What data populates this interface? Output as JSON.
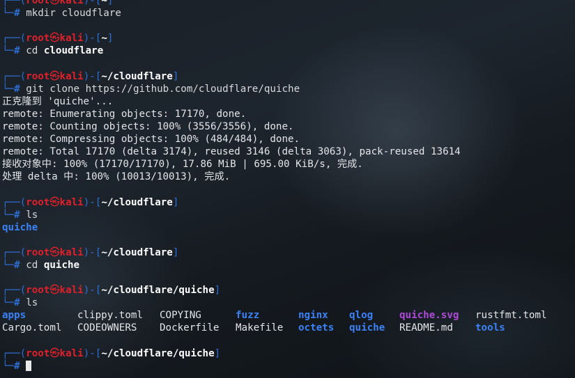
{
  "prompt": {
    "user": "root",
    "skull": "㉿",
    "host": "kali",
    "hash": "#"
  },
  "blocks": [
    {
      "path": "~",
      "cmd": "mkdir",
      "arg": "cloudflare",
      "arg_bold": false
    },
    {
      "path": "~",
      "cmd": "cd",
      "arg": "cloudflare",
      "arg_bold": true
    },
    {
      "path": "~/cloudflare",
      "cmd": "git",
      "arg": "clone https://github.com/cloudflare/quiche",
      "arg_bold": false,
      "output": [
        "正克隆到 'quiche'...",
        "remote: Enumerating objects: 17170, done.",
        "remote: Counting objects: 100% (3556/3556), done.",
        "remote: Compressing objects: 100% (484/484), done.",
        "remote: Total 17170 (delta 3174), reused 3146 (delta 3063), pack-reused 13614",
        "接收对象中: 100% (17170/17170), 17.86 MiB | 695.00 KiB/s, 完成.",
        "处理 delta 中: 100% (10013/10013), 完成."
      ]
    },
    {
      "path": "~/cloudflare",
      "cmd": "ls",
      "arg": "",
      "arg_bold": false
    },
    {
      "path": "~/cloudflare",
      "cmd": "cd",
      "arg": "quiche",
      "arg_bold": true
    },
    {
      "path": "~/cloudflare/quiche",
      "cmd": "ls",
      "arg": "",
      "arg_bold": false
    },
    {
      "path": "~/cloudflare/quiche",
      "cmd": "",
      "arg": "",
      "arg_bold": false
    }
  ],
  "ls_cloudflare": [
    "quiche"
  ],
  "ls_quiche": {
    "row1": [
      {
        "name": "apps",
        "kind": "dir"
      },
      {
        "name": "clippy.toml",
        "kind": "file"
      },
      {
        "name": "COPYING",
        "kind": "file"
      },
      {
        "name": "fuzz",
        "kind": "dir"
      },
      {
        "name": "nginx",
        "kind": "dir"
      },
      {
        "name": "qlog",
        "kind": "dir"
      },
      {
        "name": "quiche.svg",
        "kind": "svg"
      },
      {
        "name": "rustfmt.toml",
        "kind": "file"
      }
    ],
    "row2": [
      {
        "name": "Cargo.toml",
        "kind": "file"
      },
      {
        "name": "CODEOWNERS",
        "kind": "file"
      },
      {
        "name": "Dockerfile",
        "kind": "file"
      },
      {
        "name": "Makefile",
        "kind": "file"
      },
      {
        "name": "octets",
        "kind": "dir"
      },
      {
        "name": "quiche",
        "kind": "dir"
      },
      {
        "name": "README.md",
        "kind": "file"
      },
      {
        "name": "tools",
        "kind": "dir"
      }
    ]
  }
}
